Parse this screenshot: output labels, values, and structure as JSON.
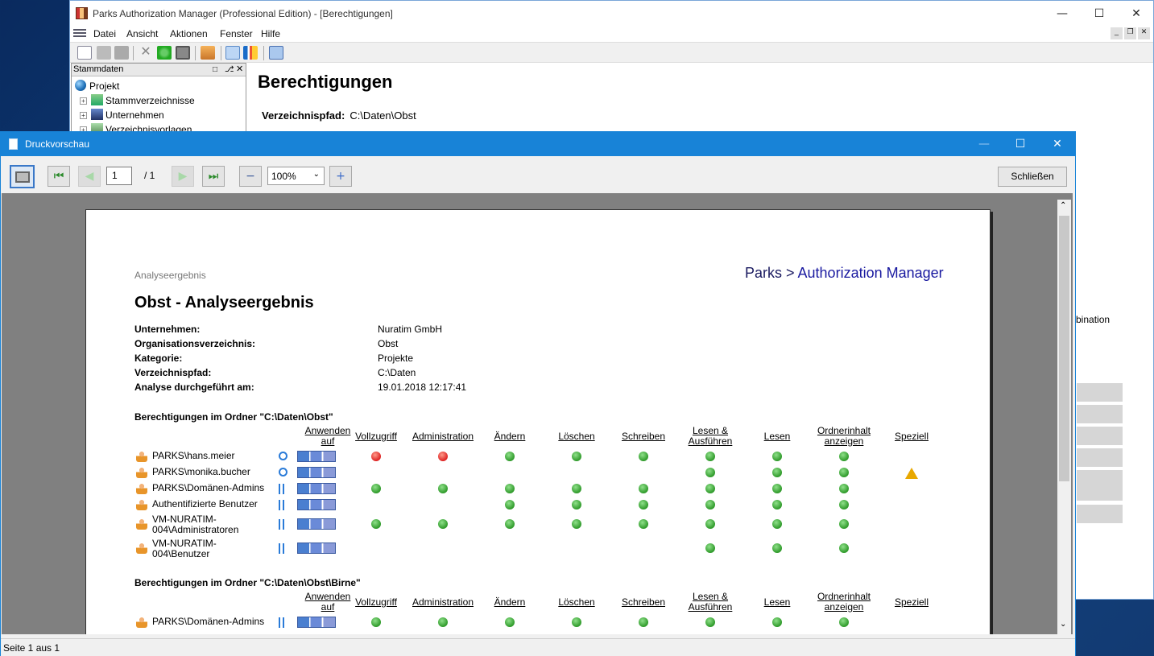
{
  "main": {
    "title": "Parks Authorization Manager (Professional Edition) - [Berechtigungen]",
    "menu": [
      "Datei",
      "Ansicht",
      "Aktionen",
      "Fenster",
      "Hilfe"
    ],
    "stamm_title": "Stammdaten",
    "tree": [
      "Projekt",
      "Stammverzeichnisse",
      "Unternehmen",
      "Verzeichnisvorlagen"
    ],
    "heading": "Berechtigungen",
    "vpfad_label": "Verzeichnispfad:",
    "vpfad_value": "C:\\Daten\\Obst",
    "side_text": "bination"
  },
  "preview": {
    "title": "Druckvorschau",
    "page_input": "1",
    "page_total": "/ 1",
    "zoom": "100%",
    "close_label": "Schließen",
    "status": "Seite 1 aus 1"
  },
  "report": {
    "header_left": "Analyseergebnis",
    "brand_a": "Parks > ",
    "brand_b": "Authorization Manager",
    "title": "Obst - Analyseergebnis",
    "fields": [
      {
        "label": "Unternehmen:",
        "value": "Nuratim GmbH"
      },
      {
        "label": "Organisationsverzeichnis:",
        "value": "Obst"
      },
      {
        "label": "Kategorie:",
        "value": "Projekte"
      },
      {
        "label": "Verzeichnispfad:",
        "value": "C:\\Daten"
      },
      {
        "label": "Analyse durchgeführt am:",
        "value": "19.01.2018 12:17:41"
      }
    ],
    "section1": "Berechtigungen im Ordner \"C:\\Daten\\Obst\"",
    "section2": "Berechtigungen im Ordner \"C:\\Daten\\Obst\\Birne\"",
    "columns": {
      "apply_1": "Anwenden",
      "apply_2": "auf",
      "full": "Vollzugriff",
      "admin": "Administration",
      "change": "Ändern",
      "delete": "Löschen",
      "write": "Schreiben",
      "readexec_1": "Lesen &",
      "readexec_2": "Ausführen",
      "read": "Lesen",
      "list_1": "Ordnerinhalt",
      "list_2": "anzeigen",
      "special": "Speziell"
    },
    "rows1": [
      {
        "l1": "PARKS\\hans.meier",
        "l2": "",
        "marks": [
          "deny",
          "deny",
          "ok",
          "ok",
          "ok",
          "ok",
          "ok",
          "ok",
          ""
        ]
      },
      {
        "l1": "PARKS\\monika.bucher",
        "l2": "",
        "marks": [
          "",
          "",
          "",
          "",
          "",
          "ok",
          "ok",
          "ok",
          "warn"
        ]
      },
      {
        "l1": "PARKS\\Domänen-Admins",
        "l2": "",
        "marks": [
          "ok",
          "ok",
          "ok",
          "ok",
          "ok",
          "ok",
          "ok",
          "ok",
          ""
        ]
      },
      {
        "l1": "Authentifizierte Benutzer",
        "l2": "",
        "marks": [
          "",
          "",
          "ok",
          "ok",
          "ok",
          "ok",
          "ok",
          "ok",
          ""
        ]
      },
      {
        "l1": "VM-NURATIM-",
        "l2": "004\\Administratoren",
        "marks": [
          "ok",
          "ok",
          "ok",
          "ok",
          "ok",
          "ok",
          "ok",
          "ok",
          ""
        ]
      },
      {
        "l1": "VM-NURATIM-",
        "l2": "004\\Benutzer",
        "marks": [
          "",
          "",
          "",
          "",
          "",
          "ok",
          "ok",
          "ok",
          ""
        ]
      }
    ],
    "rows2": [
      {
        "l1": "PARKS\\Domänen-Admins",
        "l2": "",
        "marks": [
          "ok",
          "ok",
          "ok",
          "ok",
          "ok",
          "ok",
          "ok",
          "ok",
          ""
        ]
      }
    ]
  },
  "colors": {
    "title_blue": "#1883d7",
    "brand_blue": "#1a1aa0",
    "ok": "#2f9a2a",
    "deny": "#d22",
    "warn": "#e8a800"
  }
}
